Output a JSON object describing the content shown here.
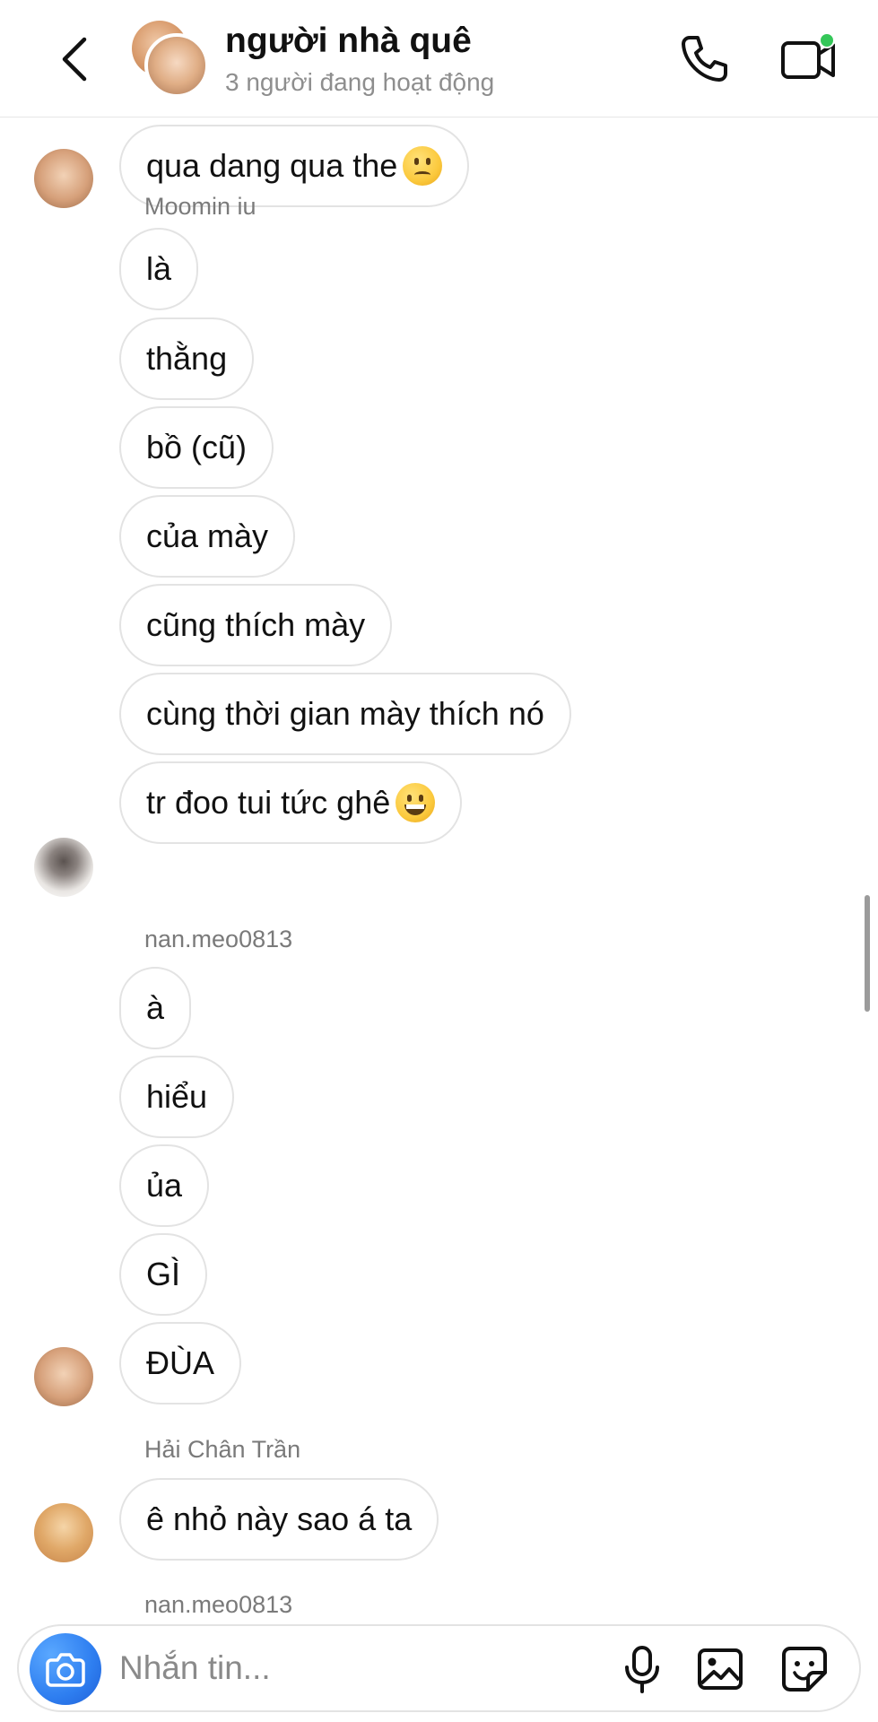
{
  "header": {
    "title": "người nhà quê",
    "subtitle": "3 người đang hoạt động"
  },
  "messages": [
    {
      "text": "qua dang qua the",
      "emoji": "disappointed-face"
    },
    {
      "sender": "Moomin iu"
    },
    {
      "text": "là"
    },
    {
      "text": "thằng"
    },
    {
      "text": "bồ (cũ)"
    },
    {
      "text": "của mày"
    },
    {
      "text": "cũng thích mày"
    },
    {
      "text": "cùng thời gian mày thích nó"
    },
    {
      "text": "tr đoo tui tức ghê ",
      "emoji": "grinning-face"
    },
    {
      "sender": "nan.meo0813"
    },
    {
      "text": "à"
    },
    {
      "text": "hiểu"
    },
    {
      "text": "ủa"
    },
    {
      "text": "GÌ"
    },
    {
      "text": "ĐÙA"
    },
    {
      "sender": "Hải Chân Trần"
    },
    {
      "text": "ê nhỏ này sao á ta"
    },
    {
      "sender": "nan.meo0813"
    }
  ],
  "composer": {
    "placeholder": "Nhắn tin..."
  },
  "colors": {
    "accent_blue": "#2e7ef0",
    "online_green": "#35c759",
    "bubble_border": "#e3e3e3",
    "secondary_text": "#8e8e8e"
  },
  "icons": [
    "back-arrow-icon",
    "phone-icon",
    "video-camera-icon",
    "camera-icon",
    "microphone-icon",
    "gallery-icon",
    "sticker-icon"
  ]
}
